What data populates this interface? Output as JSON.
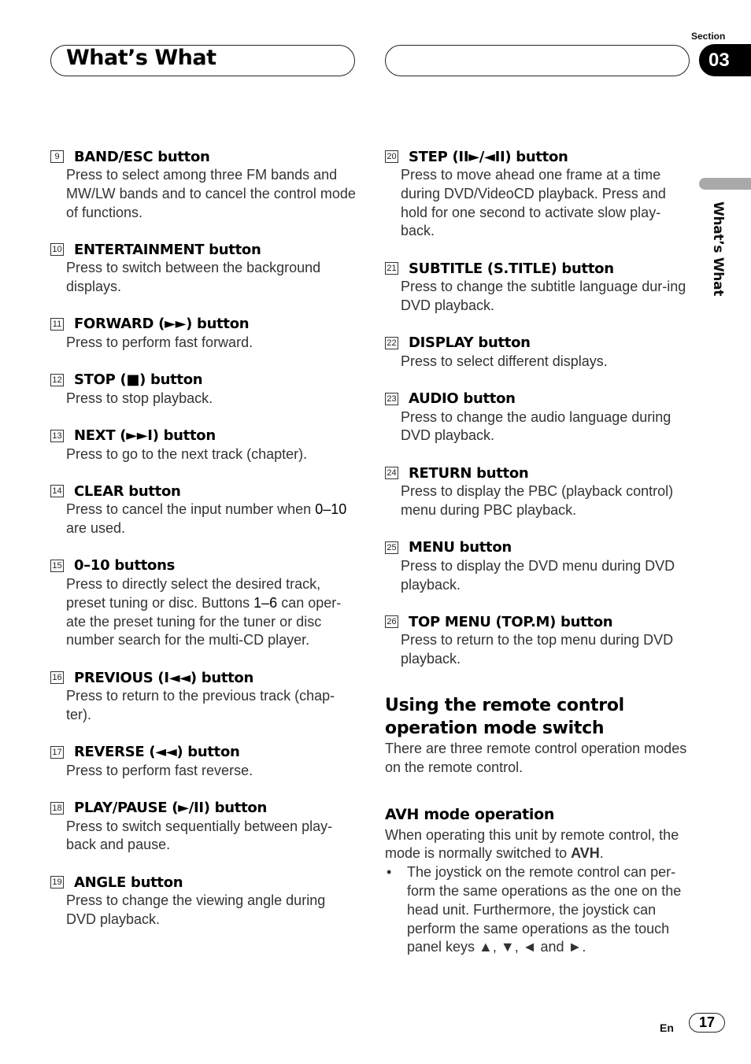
{
  "header": {
    "title": "What’s What",
    "section_label": "Section",
    "section_number": "03"
  },
  "side_tab": {
    "label": "What’s What"
  },
  "left_items": [
    {
      "num": "9",
      "title": "BAND/ESC button",
      "desc": "Press to select among three FM bands and MW/LW bands and to cancel the control mode of functions."
    },
    {
      "num": "10",
      "title": "ENTERTAINMENT button",
      "desc": "Press to switch between the background displays."
    },
    {
      "num": "11",
      "title": "FORWARD (►►) button",
      "desc": "Press to perform fast forward."
    },
    {
      "num": "12",
      "title": "STOP (■) button",
      "desc": "Press to stop playback."
    },
    {
      "num": "13",
      "title": "NEXT (►►I) button",
      "desc": "Press to go to the next track (chapter)."
    },
    {
      "num": "14",
      "title": "CLEAR button",
      "desc_pre": "Press to cancel the input number when ",
      "desc_bold": "0–10",
      "desc_post": " are used."
    },
    {
      "num": "15",
      "title": "0–10 buttons",
      "desc_pre": "Press to directly select the desired track, preset tuning or disc. Buttons ",
      "desc_bold": "1–6",
      "desc_post": " can oper-ate the preset tuning for the tuner or disc number search for the multi-CD player."
    },
    {
      "num": "16",
      "title": "PREVIOUS (I◄◄) button",
      "desc": "Press to return to the previous track (chap-ter)."
    },
    {
      "num": "17",
      "title": "REVERSE (◄◄) button",
      "desc": "Press to perform fast reverse."
    },
    {
      "num": "18",
      "title": "PLAY/PAUSE (►/II) button",
      "desc": "Press to switch sequentially between play-back and pause."
    },
    {
      "num": "19",
      "title": "ANGLE button",
      "desc": "Press to change the viewing angle during DVD playback."
    }
  ],
  "right_items": [
    {
      "num": "20",
      "title": "STEP (II►/◄II) button",
      "desc": "Press to move ahead one frame at a time during DVD/VideoCD playback. Press and hold for one second to activate slow play-back."
    },
    {
      "num": "21",
      "title": "SUBTITLE (S.TITLE) button",
      "desc": "Press to change the subtitle language dur-ing DVD playback."
    },
    {
      "num": "22",
      "title": "DISPLAY button",
      "desc": "Press to select different displays."
    },
    {
      "num": "23",
      "title": "AUDIO button",
      "desc": "Press to change the audio language during DVD playback."
    },
    {
      "num": "24",
      "title": "RETURN button",
      "desc": "Press to display the PBC (playback control) menu during PBC playback."
    },
    {
      "num": "25",
      "title": "MENU button",
      "desc": "Press to display the DVD menu during DVD playback."
    },
    {
      "num": "26",
      "title": "TOP MENU (TOP.M) button",
      "desc": "Press to return to the top menu during DVD playback."
    }
  ],
  "remote_section": {
    "heading": "Using the remote control operation mode switch",
    "intro": "There are three remote control operation modes on the remote control.",
    "subheading": "AVH mode operation",
    "para_pre": "When operating this unit by remote control, the mode is normally switched to ",
    "para_bold": "AVH",
    "para_post": ".",
    "bullet_symbol": "•",
    "bullet": "The joystick on the remote control can per-form the same operations as the one on the head unit. Furthermore, the joystick can perform the same operations as the touch panel keys ▲, ▼, ◄ and ►."
  },
  "footer": {
    "lang": "En",
    "page": "17"
  }
}
